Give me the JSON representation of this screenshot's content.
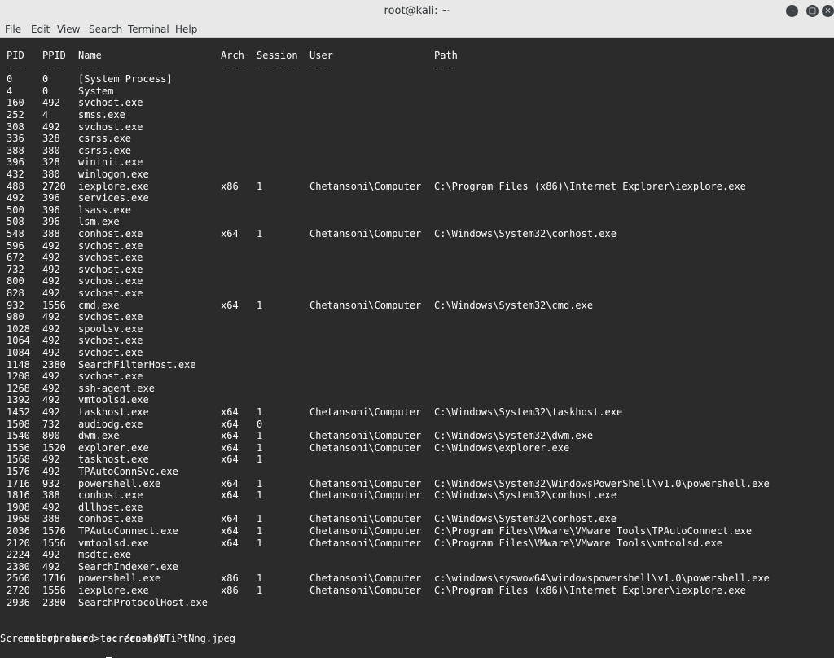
{
  "window": {
    "title": "root@kali: ~",
    "buttons": [
      "minimize",
      "maximize",
      "close"
    ]
  },
  "menu": [
    "File",
    "Edit",
    "View",
    "Search",
    "Terminal",
    "Help"
  ],
  "table": {
    "headers": [
      "PID",
      "PPID",
      "Name",
      "Arch",
      "Session",
      "User",
      "Path"
    ],
    "separators": [
      "---",
      "----",
      "----",
      "----",
      "-------",
      "----",
      "----"
    ],
    "rows": [
      [
        "0",
        "0",
        "[System Process]",
        "",
        "",
        "",
        ""
      ],
      [
        "4",
        "0",
        "System",
        "",
        "",
        "",
        ""
      ],
      [
        "160",
        "492",
        "svchost.exe",
        "",
        "",
        "",
        ""
      ],
      [
        "252",
        "4",
        "smss.exe",
        "",
        "",
        "",
        ""
      ],
      [
        "308",
        "492",
        "svchost.exe",
        "",
        "",
        "",
        ""
      ],
      [
        "336",
        "328",
        "csrss.exe",
        "",
        "",
        "",
        ""
      ],
      [
        "388",
        "380",
        "csrss.exe",
        "",
        "",
        "",
        ""
      ],
      [
        "396",
        "328",
        "wininit.exe",
        "",
        "",
        "",
        ""
      ],
      [
        "432",
        "380",
        "winlogon.exe",
        "",
        "",
        "",
        ""
      ],
      [
        "488",
        "2720",
        "iexplore.exe",
        "x86",
        "1",
        "Chetansoni\\Computer",
        "C:\\Program Files (x86)\\Internet Explorer\\iexplore.exe"
      ],
      [
        "492",
        "396",
        "services.exe",
        "",
        "",
        "",
        ""
      ],
      [
        "500",
        "396",
        "lsass.exe",
        "",
        "",
        "",
        ""
      ],
      [
        "508",
        "396",
        "lsm.exe",
        "",
        "",
        "",
        ""
      ],
      [
        "548",
        "388",
        "conhost.exe",
        "x64",
        "1",
        "Chetansoni\\Computer",
        "C:\\Windows\\System32\\conhost.exe"
      ],
      [
        "596",
        "492",
        "svchost.exe",
        "",
        "",
        "",
        ""
      ],
      [
        "672",
        "492",
        "svchost.exe",
        "",
        "",
        "",
        ""
      ],
      [
        "732",
        "492",
        "svchost.exe",
        "",
        "",
        "",
        ""
      ],
      [
        "800",
        "492",
        "svchost.exe",
        "",
        "",
        "",
        ""
      ],
      [
        "828",
        "492",
        "svchost.exe",
        "",
        "",
        "",
        ""
      ],
      [
        "932",
        "1556",
        "cmd.exe",
        "x64",
        "1",
        "Chetansoni\\Computer",
        "C:\\Windows\\System32\\cmd.exe"
      ],
      [
        "980",
        "492",
        "svchost.exe",
        "",
        "",
        "",
        ""
      ],
      [
        "1028",
        "492",
        "spoolsv.exe",
        "",
        "",
        "",
        ""
      ],
      [
        "1064",
        "492",
        "svchost.exe",
        "",
        "",
        "",
        ""
      ],
      [
        "1084",
        "492",
        "svchost.exe",
        "",
        "",
        "",
        ""
      ],
      [
        "1148",
        "2380",
        "SearchFilterHost.exe",
        "",
        "",
        "",
        ""
      ],
      [
        "1208",
        "492",
        "svchost.exe",
        "",
        "",
        "",
        ""
      ],
      [
        "1268",
        "492",
        "ssh-agent.exe",
        "",
        "",
        "",
        ""
      ],
      [
        "1392",
        "492",
        "vmtoolsd.exe",
        "",
        "",
        "",
        ""
      ],
      [
        "1452",
        "492",
        "taskhost.exe",
        "x64",
        "1",
        "Chetansoni\\Computer",
        "C:\\Windows\\System32\\taskhost.exe"
      ],
      [
        "1508",
        "732",
        "audiodg.exe",
        "x64",
        "0",
        "",
        ""
      ],
      [
        "1540",
        "800",
        "dwm.exe",
        "x64",
        "1",
        "Chetansoni\\Computer",
        "C:\\Windows\\System32\\dwm.exe"
      ],
      [
        "1556",
        "1520",
        "explorer.exe",
        "x64",
        "1",
        "Chetansoni\\Computer",
        "C:\\Windows\\explorer.exe"
      ],
      [
        "1568",
        "492",
        "taskhost.exe",
        "x64",
        "1",
        "",
        ""
      ],
      [
        "1576",
        "492",
        "TPAutoConnSvc.exe",
        "",
        "",
        "",
        ""
      ],
      [
        "1716",
        "932",
        "powershell.exe",
        "x64",
        "1",
        "Chetansoni\\Computer",
        "C:\\Windows\\System32\\WindowsPowerShell\\v1.0\\powershell.exe"
      ],
      [
        "1816",
        "388",
        "conhost.exe",
        "x64",
        "1",
        "Chetansoni\\Computer",
        "C:\\Windows\\System32\\conhost.exe"
      ],
      [
        "1908",
        "492",
        "dllhost.exe",
        "",
        "",
        "",
        ""
      ],
      [
        "1968",
        "388",
        "conhost.exe",
        "x64",
        "1",
        "Chetansoni\\Computer",
        "C:\\Windows\\System32\\conhost.exe"
      ],
      [
        "2036",
        "1576",
        "TPAutoConnect.exe",
        "x64",
        "1",
        "Chetansoni\\Computer",
        "C:\\Program Files\\VMware\\VMware Tools\\TPAutoConnect.exe"
      ],
      [
        "2120",
        "1556",
        "vmtoolsd.exe",
        "x64",
        "1",
        "Chetansoni\\Computer",
        "C:\\Program Files\\VMware\\VMware Tools\\vmtoolsd.exe"
      ],
      [
        "2224",
        "492",
        "msdtc.exe",
        "",
        "",
        "",
        ""
      ],
      [
        "2380",
        "492",
        "SearchIndexer.exe",
        "",
        "",
        "",
        ""
      ],
      [
        "2560",
        "1716",
        "powershell.exe",
        "x86",
        "1",
        "Chetansoni\\Computer",
        "c:\\windows\\syswow64\\windowspowershell\\v1.0\\powershell.exe"
      ],
      [
        "2720",
        "1556",
        "iexplore.exe",
        "x86",
        "1",
        "Chetansoni\\Computer",
        "C:\\Program Files (x86)\\Internet Explorer\\iexplore.exe"
      ],
      [
        "2936",
        "2380",
        "SearchProtocolHost.exe",
        "",
        "",
        "",
        ""
      ]
    ]
  },
  "console": {
    "prompt_word": "meterpreter",
    "prompt_suffix": " > ",
    "command": "screenshot",
    "output": "Screenshot saved to: /root/WTiPtNng.jpeg"
  }
}
